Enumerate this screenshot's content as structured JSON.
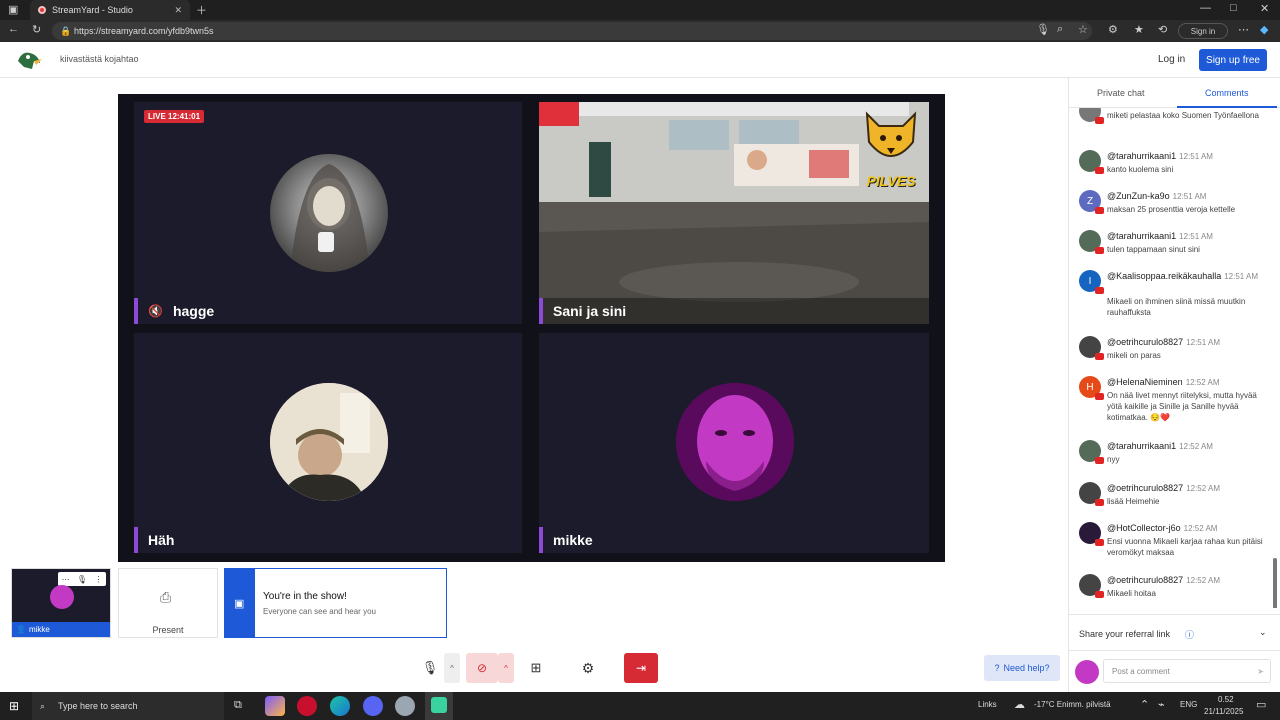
{
  "browser": {
    "tab_title": "StreamYard - Studio",
    "url": "https://streamyard.com/yfdb9twn5s",
    "sign_in": "Sign in"
  },
  "app": {
    "title": "kiivastästä kojahtao",
    "login": "Log in",
    "signup": "Sign up free"
  },
  "stage": {
    "live_badge": "LIVE 12:41:01",
    "tiles": [
      {
        "name": "hagge",
        "muted": true
      },
      {
        "name": "Sani ja sini",
        "muted": false
      },
      {
        "name": "Häh",
        "muted": false
      },
      {
        "name": "mikke",
        "muted": false
      }
    ],
    "overlay_text": "PILVES"
  },
  "bottom": {
    "self_label": "mikke",
    "present_label": "Present",
    "toast_title": "You're in the show!",
    "toast_sub": "Everyone can see and hear you",
    "need_help": "Need help?"
  },
  "panel": {
    "tab_private": "Private chat",
    "tab_comments": "Comments",
    "share_label": "Share your referral link",
    "post_placeholder": "Post a comment",
    "comments": [
      {
        "user": "",
        "time": "",
        "text": "miketi pelastaa koko Suomen Työnfaellona",
        "avatar": "",
        "color": "#777"
      },
      {
        "user": "@tarahurrikaani1",
        "time": "12:51 AM",
        "text": "kanto kuolema sini",
        "avatar": "",
        "color": "#556b5a"
      },
      {
        "user": "@ZunZun-ka9o",
        "time": "12:51 AM",
        "text": "maksan 25 prosenttia veroja kettelle",
        "avatar": "Z",
        "color": "#5c6bc0"
      },
      {
        "user": "@tarahurrikaani1",
        "time": "12:51 AM",
        "text": "tulen tappamaan sinut sini",
        "avatar": "",
        "color": "#556b5a"
      },
      {
        "user": "@Kaalisoppaa.reikäkauhalla",
        "time": "12:51 AM",
        "text": "Mikaeli on ihminen siinä missä muutkin rauhaffuksta",
        "avatar": "I",
        "color": "#1565c0"
      },
      {
        "user": "@oetrihcurulo8827",
        "time": "12:51 AM",
        "text": "mikeli on paras",
        "avatar": "",
        "color": "#444"
      },
      {
        "user": "@HelenaNieminen",
        "time": "12:52 AM",
        "text": "On nää livet mennyt riitelyksi, mutta hyvää yötä kaikille ja Sinille ja Sanille hyvää kotimatkaa. 😔❤️",
        "avatar": "H",
        "color": "#e64a19"
      },
      {
        "user": "@tarahurrikaani1",
        "time": "12:52 AM",
        "text": "nyy",
        "avatar": "",
        "color": "#556b5a"
      },
      {
        "user": "@oetrihcurulo8827",
        "time": "12:52 AM",
        "text": "lisää Heimehie",
        "avatar": "",
        "color": "#444"
      },
      {
        "user": "@HotCollector-j6o",
        "time": "12:52 AM",
        "text": "Ensi vuonna Mikaeli karjaa rahaa kun pitäisi veromökyt maksaa",
        "avatar": "",
        "color": "#2a1a3a"
      },
      {
        "user": "@oetrihcurulo8827",
        "time": "12:52 AM",
        "text": "Mikaeli hoitaa",
        "avatar": "",
        "color": "#444"
      }
    ]
  },
  "taskbar": {
    "search": "Type here to search",
    "links": "Links",
    "weather": "-17°C Enimm. pilvistä",
    "lang": "ENG",
    "time": "0.52",
    "date": "21/11/2025"
  },
  "colors": {
    "accent": "#1e5ad7",
    "live": "#d62b35",
    "name_bar": "#8c4bd6",
    "leave": "#d62b35"
  }
}
